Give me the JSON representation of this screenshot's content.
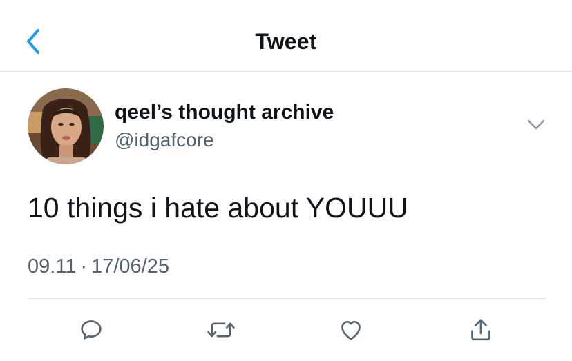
{
  "header": {
    "title": "Tweet",
    "back_icon": "chevron-left-icon"
  },
  "tweet": {
    "author": {
      "display_name": "qeel’s thought archive",
      "handle": "@idgafcore"
    },
    "menu_icon": "chevron-down-icon",
    "text": "10 things i hate about YOUUU",
    "time": "09.11",
    "separator": "·",
    "date": "17/06/25"
  },
  "actions": [
    {
      "name": "reply",
      "icon": "comment-icon"
    },
    {
      "name": "retweet",
      "icon": "retweet-icon"
    },
    {
      "name": "like",
      "icon": "heart-icon"
    },
    {
      "name": "share",
      "icon": "share-icon"
    }
  ],
  "colors": {
    "accent": "#1d9bf0",
    "text_primary": "#0f1419",
    "text_secondary": "#536471",
    "icon_gray": "#536471",
    "divider": "#dfe3e7"
  }
}
